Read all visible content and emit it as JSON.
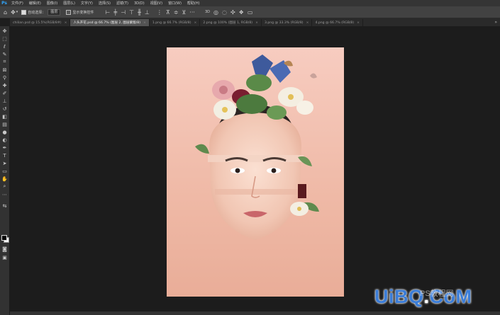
{
  "menubar": {
    "logo": "Ps",
    "items": [
      "文件(F)",
      "编辑(E)",
      "图像(I)",
      "图层(L)",
      "文字(Y)",
      "选择(S)",
      "滤镜(T)",
      "3D(D)",
      "视图(V)",
      "窗口(W)",
      "帮助(H)"
    ]
  },
  "options": {
    "auto_select_label": "自动选择：",
    "auto_select_value": "图层",
    "transform_label": "显示变换控件"
  },
  "tabs": [
    {
      "label": "chilian.psd @ 15.5%(RGB/8#)",
      "active": false
    },
    {
      "label": "人头开花.psd @ 66.7% (图层 2, 图层蒙版/8)",
      "active": true
    },
    {
      "label": "1.png @ 66.7% (RGB/8)",
      "active": false
    },
    {
      "label": "2.png @ 100% (图层 1, RGB/8)",
      "active": false
    },
    {
      "label": "3.png @ 33.3% (RGB/8)",
      "active": false
    },
    {
      "label": "4.png @ 66.7% (RGB/8)",
      "active": false
    }
  ],
  "tabs_more": "»",
  "tools": [
    "move-icon",
    "marquee-icon",
    "lasso-icon",
    "quick-select-icon",
    "crop-icon",
    "frame-icon",
    "eyedropper-icon",
    "healing-icon",
    "brush-icon",
    "stamp-icon",
    "history-brush-icon",
    "eraser-icon",
    "gradient-icon",
    "blur-icon",
    "dodge-icon",
    "pen-icon",
    "type-icon",
    "path-select-icon",
    "shape-icon",
    "hand-icon",
    "zoom-icon",
    "more-icon"
  ],
  "watermark": {
    "brand_a": "UiB",
    "brand_b": "Q",
    "brand_dot": ".",
    "brand_c": "CoM",
    "faint": "PS教程网"
  },
  "colors": {
    "foreground": "#000000",
    "background": "#ffffff",
    "accent": "#31a8ff"
  }
}
